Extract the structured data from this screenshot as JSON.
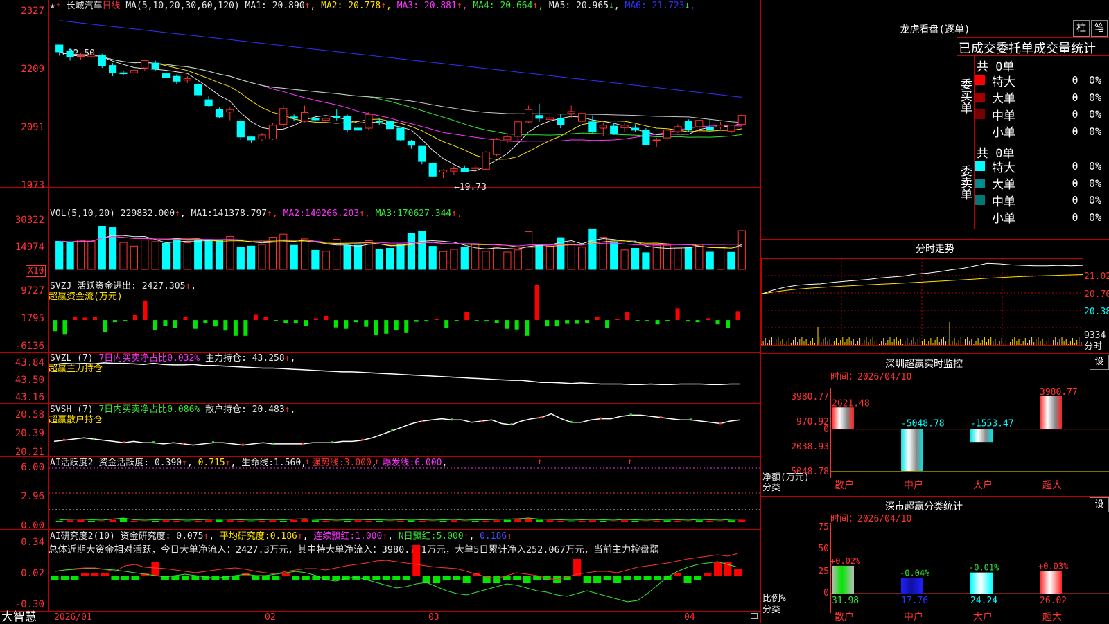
{
  "header": {
    "stock_name": "长城汽车",
    "period": "日线",
    "ma_def": "MA(5,10,20,30,60,120)",
    "ma_values": [
      {
        "label": "MA1:",
        "value": "20.890",
        "arrow": "↑",
        "color": "#e6e6e6"
      },
      {
        "label": "MA2:",
        "value": "20.778",
        "arrow": "↑",
        "color": "#ffe100"
      },
      {
        "label": "MA3:",
        "value": "20.881",
        "arrow": "↑",
        "color": "#ff32ff"
      },
      {
        "label": "MA4:",
        "value": "20.664",
        "arrow": "↑",
        "color": "#32e632"
      },
      {
        "label": "MA5:",
        "value": "20.965",
        "arrow": "↓",
        "color": "#e6e6e6"
      },
      {
        "label": "MA6:",
        "value": "21.723",
        "arrow": "↓",
        "color": "#3232ff"
      }
    ]
  },
  "main_axis": [
    "2327",
    "2209",
    "2091",
    "1973"
  ],
  "annotations": {
    "high": "22.50",
    "low": "19.73"
  },
  "vol_panel": {
    "axis": [
      "30322",
      "14974"
    ],
    "unit": "X10",
    "label": "VOL(5,10,20)",
    "value": "229832.000",
    "mas": [
      {
        "label": "MA1:",
        "value": "141378.797",
        "color": "#e6e6e6"
      },
      {
        "label": "MA2:",
        "value": "140266.203",
        "color": "#ff32ff"
      },
      {
        "label": "MA3:",
        "value": "170627.344",
        "color": "#32e632"
      }
    ]
  },
  "svzj_panel": {
    "axis": [
      "9727",
      "1795",
      "-6136"
    ],
    "label": "SVZJ",
    "text": "活跃资金进出:",
    "value": "2427.305",
    "sub": "超赢资金流(万元)"
  },
  "svzl_panel": {
    "axis": [
      "43.84",
      "43.50",
      "43.16"
    ],
    "label": "SVZL (7)",
    "ratio": "7日内买卖净占比0.032%",
    "hold_label": "主力持仓:",
    "hold_value": "43.258",
    "sub": "超赢主力持仓"
  },
  "svsh_panel": {
    "axis": [
      "20.58",
      "20.39",
      "20.21"
    ],
    "label": "SVSH (7)",
    "ratio": "7日内买卖净占比0.086%",
    "hold_label": "散户持仓:",
    "hold_value": "20.483",
    "sub": "超赢散户持仓"
  },
  "ai_active": {
    "axis": [
      "6.00",
      "2.96",
      "0.00"
    ],
    "label": "AI活跃度2",
    "text1": "资金活跃度:",
    "v1": "0.390",
    "v2": "0.715",
    "life_label": "生命线:",
    "life": "1.560",
    "strong_label": "强势线:",
    "strong": "3.000",
    "burst_label": "爆发线:",
    "burst": "6.000"
  },
  "ai_research": {
    "axis": [
      "0.34",
      "0.02",
      "-0.30"
    ],
    "label": "AI研究度2(10)",
    "text1": "资金研究度:",
    "v1": "0.075",
    "avg_label": "平均研究度:",
    "avg": "0.186",
    "cont_label": "连续飘红:",
    "cont": "1.000",
    "nday_label": "N日飘红:",
    "nday": "5.000",
    "extra": "0.186",
    "summary": "总体近期大资金相对活跃，今日大单净流入：2427.3万元，其中特大单净流入：3980.771万元，大单5日累计净入252.067万元，当前主力控盘弱"
  },
  "x_axis": [
    "2026/01",
    "02",
    "03",
    "04"
  ],
  "brand": "大智慧",
  "right": {
    "lhb_title": "龙虎看盘(逐单)",
    "btn_bar": "柱",
    "btn_pen": "笔",
    "table_title": "已成交委托单成交量统计",
    "buy_label": "委买单",
    "sell_label": "委卖单",
    "buy_total": "共 0单",
    "sell_total": "共 0单",
    "buy_rows": [
      {
        "name": "特大",
        "count": "0",
        "pct": "0%",
        "color": "#ff0000"
      },
      {
        "name": "大单",
        "count": "0",
        "pct": "0%",
        "color": "#a00000"
      },
      {
        "name": "中单",
        "count": "0",
        "pct": "0%",
        "color": "#780000"
      },
      {
        "name": "小单",
        "count": "0",
        "pct": "0%",
        "color": "#000000"
      }
    ],
    "sell_rows": [
      {
        "name": "特大",
        "count": "0",
        "pct": "0%",
        "color": "#00ffff"
      },
      {
        "name": "大单",
        "count": "0",
        "pct": "0%",
        "color": "#008c8c"
      },
      {
        "name": "中单",
        "count": "0",
        "pct": "0%",
        "color": "#007878"
      },
      {
        "name": "小单",
        "count": "0",
        "pct": "0%",
        "color": "#000000"
      }
    ],
    "intraday_title": "分时走势",
    "intraday_axis": [
      "21.02",
      "20.70",
      "20.38"
    ],
    "intraday_vol": "9334",
    "intraday_unit": "分时",
    "sz_monitor_title": "深圳超赢实时监控",
    "sz_set": "设",
    "sz_time": "时间：2026/04/10",
    "sz_axis": [
      "3980.77",
      "970.92",
      "0",
      "-2038.93",
      "-5048.78"
    ],
    "sz_unit1": "净额(万元)",
    "sz_unit2": "分类",
    "sz_cats": [
      "散户",
      "中户",
      "大户",
      "超大"
    ],
    "sz_labels": [
      "2621.48",
      "-5048.78",
      "-1553.47",
      "3980.77"
    ],
    "sz_values": [
      2621.48,
      -5048.78,
      -1553.47,
      3980.77
    ],
    "sz_stat_title": "深市超赢分类统计",
    "sz_stat_set": "设",
    "sz_stat_time": "时间：2026/04/10",
    "sz_stat_axis": [
      "75",
      "50",
      "25",
      "0"
    ],
    "sz_stat_unit1": "比例%",
    "sz_stat_unit2": "分类",
    "sz_stat_cats": [
      "散户",
      "中户",
      "大户",
      "超大"
    ],
    "sz_stat_top": [
      "+0.02%",
      "-0.04%",
      "-0.01%",
      "+0.03%"
    ],
    "sz_stat_bottom": [
      "31.98",
      "17.76",
      "24.24",
      "26.02"
    ],
    "sz_stat_values": [
      31.98,
      17.76,
      24.24,
      26.02
    ]
  },
  "chart_data": [
    {
      "type": "candlestick",
      "title": "长城汽车 日线",
      "ylim": [
        19.73,
        23.27
      ],
      "ohlc": [
        [
          22.52,
          22.5,
          22.3,
          22.38
        ],
        [
          22.4,
          22.45,
          22.2,
          22.28
        ],
        [
          22.3,
          22.35,
          22.22,
          22.3
        ],
        [
          22.28,
          22.38,
          22.25,
          22.32
        ],
        [
          22.3,
          22.34,
          22.05,
          22.1
        ],
        [
          22.1,
          22.15,
          21.88,
          21.95
        ],
        [
          21.95,
          22.0,
          21.9,
          21.93
        ],
        [
          21.95,
          22.02,
          21.92,
          22.0
        ],
        [
          22.05,
          22.22,
          22.0,
          22.2
        ],
        [
          22.15,
          22.2,
          21.98,
          22.03
        ],
        [
          21.93,
          21.98,
          21.85,
          21.85
        ],
        [
          21.88,
          21.92,
          21.72,
          21.78
        ],
        [
          21.8,
          21.88,
          21.74,
          21.83
        ],
        [
          21.72,
          21.8,
          21.45,
          21.5
        ],
        [
          21.4,
          21.48,
          21.25,
          21.28
        ],
        [
          21.2,
          21.24,
          21.02,
          21.05
        ],
        [
          21.15,
          21.24,
          20.98,
          21.2
        ],
        [
          20.96,
          21.0,
          20.58,
          20.64
        ],
        [
          20.64,
          20.66,
          20.52,
          20.58
        ],
        [
          20.6,
          20.72,
          20.55,
          20.68
        ],
        [
          20.6,
          20.92,
          20.58,
          20.88
        ],
        [
          20.9,
          21.3,
          20.85,
          21.22
        ],
        [
          21.05,
          21.1,
          20.96,
          21.02
        ],
        [
          20.96,
          21.28,
          20.94,
          21.14
        ],
        [
          21.02,
          21.08,
          20.95,
          20.99
        ],
        [
          20.98,
          21.04,
          20.94,
          21.02
        ],
        [
          21.06,
          21.2,
          20.98,
          21.03
        ],
        [
          21.07,
          21.1,
          20.73,
          20.8
        ],
        [
          20.82,
          20.88,
          20.72,
          20.78
        ],
        [
          20.82,
          21.15,
          20.78,
          21.1
        ],
        [
          20.96,
          21.02,
          20.88,
          20.95
        ],
        [
          20.96,
          21.0,
          20.81,
          20.81
        ],
        [
          20.82,
          20.82,
          20.55,
          20.58
        ],
        [
          20.55,
          20.58,
          20.4,
          20.47
        ],
        [
          20.45,
          20.46,
          20.08,
          20.14
        ],
        [
          20.1,
          20.12,
          19.83,
          19.84
        ],
        [
          19.92,
          19.98,
          19.8,
          19.96
        ],
        [
          19.94,
          20.04,
          19.87,
          19.99
        ],
        [
          20.0,
          20.06,
          19.92,
          19.92
        ],
        [
          20.0,
          20.08,
          19.94,
          20.01
        ],
        [
          19.98,
          20.35,
          19.96,
          20.33
        ],
        [
          20.28,
          20.62,
          20.25,
          20.59
        ],
        [
          20.58,
          20.7,
          20.5,
          20.64
        ],
        [
          20.65,
          20.96,
          20.55,
          20.95
        ],
        [
          20.95,
          21.28,
          20.92,
          21.2
        ],
        [
          21.08,
          21.32,
          20.95,
          21.02
        ],
        [
          21.0,
          21.12,
          20.95,
          21.03
        ],
        [
          21.02,
          21.1,
          20.82,
          20.89
        ],
        [
          21.12,
          21.28,
          21.02,
          21.16
        ],
        [
          20.96,
          21.3,
          20.92,
          21.12
        ],
        [
          20.95,
          21.08,
          20.72,
          20.74
        ],
        [
          20.82,
          20.94,
          20.65,
          20.88
        ],
        [
          20.86,
          20.92,
          20.68,
          20.7
        ],
        [
          20.83,
          20.93,
          20.74,
          20.88
        ],
        [
          20.82,
          20.9,
          20.74,
          20.78
        ],
        [
          20.78,
          20.82,
          20.48,
          20.48
        ],
        [
          20.58,
          20.62,
          20.44,
          20.58
        ],
        [
          20.62,
          20.82,
          20.55,
          20.78
        ],
        [
          20.75,
          20.9,
          20.72,
          20.85
        ],
        [
          20.96,
          21.0,
          20.75,
          20.78
        ],
        [
          20.85,
          21.0,
          20.73,
          20.98
        ],
        [
          20.84,
          21.0,
          20.75,
          20.78
        ],
        [
          20.84,
          20.95,
          20.8,
          20.88
        ],
        [
          20.76,
          20.88,
          20.72,
          20.88
        ],
        [
          20.9,
          21.12,
          20.84,
          21.08
        ]
      ]
    },
    {
      "type": "bar",
      "title": "VOL",
      "ylim": [
        0,
        30322
      ],
      "values": [
        14000,
        13500,
        14500,
        14000,
        21500,
        20800,
        13400,
        11600,
        14600,
        13800,
        13000,
        15400,
        13300,
        15000,
        14900,
        14400,
        16400,
        11100,
        11600,
        12400,
        16000,
        17500,
        12000,
        15200,
        9500,
        9000,
        15000,
        12000,
        12000,
        14300,
        10000,
        10500,
        12500,
        18000,
        19000,
        11500,
        8900,
        10000,
        10900,
        12500,
        9000,
        11000,
        8600,
        9700,
        18800,
        11800,
        11600,
        15800,
        13500,
        11100,
        20200,
        16000,
        13700,
        9700,
        10500,
        8300,
        12000,
        12000,
        10600,
        11000,
        12400,
        8600,
        12400,
        8500,
        19300
      ],
      "up": [
        false,
        false,
        true,
        true,
        false,
        false,
        true,
        true,
        true,
        true,
        false,
        false,
        true,
        false,
        false,
        false,
        true,
        false,
        false,
        true,
        true,
        true,
        false,
        true,
        false,
        true,
        true,
        false,
        false,
        true,
        false,
        false,
        false,
        false,
        false,
        false,
        true,
        true,
        false,
        true,
        true,
        true,
        true,
        true,
        true,
        false,
        true,
        false,
        true,
        true,
        false,
        true,
        false,
        true,
        false,
        false,
        true,
        true,
        true,
        false,
        true,
        false,
        true,
        false,
        true
      ]
    },
    {
      "type": "bar",
      "title": "SVZJ",
      "ylim": [
        -6136,
        9727
      ],
      "values": [
        -3200,
        -4000,
        1000,
        700,
        1000,
        -3500,
        -600,
        -200,
        1400,
        5600,
        -2800,
        -1600,
        -2200,
        1000,
        -2500,
        -800,
        -1800,
        -3000,
        -4500,
        -4500,
        1500,
        800,
        -200,
        -800,
        -800,
        -1600,
        500,
        1200,
        -2100,
        -2500,
        -600,
        -1900,
        -4200,
        -3900,
        -2800,
        -3700,
        -500,
        -400,
        300,
        -2200,
        -300,
        2200,
        -200,
        -400,
        -800,
        -2500,
        -2700,
        -4500,
        10000,
        -1800,
        -1800,
        -1100,
        -1100,
        -800,
        1000,
        -2300,
        300,
        2300,
        -300,
        -200,
        -1200,
        -100,
        3300,
        -400,
        -600,
        500,
        -1200,
        -2200,
        2500
      ]
    },
    {
      "type": "line",
      "title": "SVZL",
      "ylim": [
        43.16,
        43.84
      ],
      "values": [
        43.72,
        43.74,
        43.73,
        43.74,
        43.73,
        43.75,
        43.74,
        43.74,
        43.73,
        43.72,
        43.74,
        43.72,
        43.71,
        43.71,
        43.72,
        43.7,
        43.7,
        43.69,
        43.68,
        43.67,
        43.66,
        43.65,
        43.65,
        43.64,
        43.63,
        43.62,
        43.61,
        43.6,
        43.59,
        43.58,
        43.58,
        43.57,
        43.56,
        43.55,
        43.54,
        43.53,
        43.52,
        43.51,
        43.5,
        43.49,
        43.48,
        43.47,
        43.46,
        43.45,
        43.44,
        43.43,
        43.42,
        43.42,
        43.4,
        43.38,
        43.38,
        43.37,
        43.36,
        43.37,
        43.36,
        43.35,
        43.35,
        43.35,
        43.34,
        43.34,
        43.35,
        43.34,
        43.34,
        43.35,
        43.35,
        43.35,
        43.34,
        43.34,
        43.35,
        43.35
      ]
    },
    {
      "type": "line",
      "title": "SVSH",
      "ylim": [
        20.21,
        20.58
      ],
      "values": [
        20.3,
        20.31,
        20.32,
        20.33,
        20.32,
        20.31,
        20.3,
        20.29,
        20.3,
        20.29,
        20.29,
        20.28,
        20.29,
        20.28,
        20.27,
        20.28,
        20.29,
        20.29,
        20.28,
        20.27,
        20.28,
        20.29,
        20.28,
        20.28,
        20.28,
        20.28,
        20.29,
        20.29,
        20.29,
        20.3,
        20.3,
        20.31,
        20.33,
        20.36,
        20.39,
        20.42,
        20.45,
        20.47,
        20.48,
        20.49,
        20.48,
        20.48,
        20.46,
        20.47,
        20.48,
        20.45,
        20.44,
        20.47,
        20.49,
        20.5,
        20.53,
        20.49,
        20.46,
        20.46,
        20.48,
        20.49,
        20.49,
        20.51,
        20.52,
        20.52,
        20.51,
        20.5,
        20.49,
        20.48,
        20.48,
        20.47,
        20.46,
        20.45,
        20.47,
        20.48
      ]
    },
    {
      "type": "line",
      "title": "分时走势",
      "ylim": [
        20.06,
        21.34
      ],
      "values": [
        20.62,
        20.7,
        20.76,
        20.8,
        20.82,
        20.83,
        20.86,
        20.88,
        20.9,
        20.92,
        20.95,
        20.97,
        20.99,
        21.03,
        21.05,
        21.08,
        21.12,
        21.15,
        21.2,
        21.25,
        21.24,
        21.22,
        21.21,
        21.2,
        21.2,
        21.21,
        21.2,
        21.21
      ]
    }
  ]
}
